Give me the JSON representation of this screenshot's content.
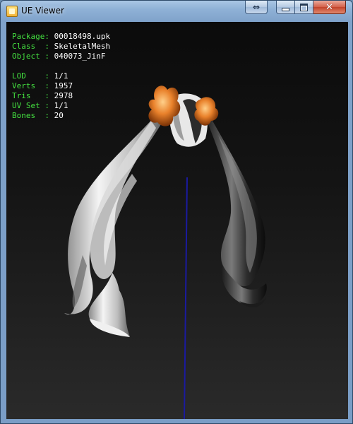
{
  "window": {
    "title": "UE Viewer",
    "controls": {
      "extra": "⇔",
      "minimize": "minimize",
      "maximize": "maximize",
      "close": "✕"
    }
  },
  "info": {
    "package": {
      "key": "Package",
      "sep": ": ",
      "value": "00018498.upk"
    },
    "class": {
      "key": "Class  ",
      "sep": ": ",
      "value": "SkeletalMesh"
    },
    "object": {
      "key": "Object ",
      "sep": ": ",
      "value": "040073_JinF"
    },
    "lod": {
      "key": "LOD    ",
      "sep": ": ",
      "value": "1/1"
    },
    "verts": {
      "key": "Verts  ",
      "sep": ": ",
      "value": "1957"
    },
    "tris": {
      "key": "Tris   ",
      "sep": ": ",
      "value": "2978"
    },
    "uvset": {
      "key": "UV Set ",
      "sep": ": ",
      "value": "1/1"
    },
    "bones": {
      "key": "Bones  ",
      "sep": ": ",
      "value": "20"
    }
  },
  "colors": {
    "label": "#44e040",
    "value": "#ffffff",
    "axis": "#1a1aa0",
    "ribbon": "#e07b2a"
  }
}
